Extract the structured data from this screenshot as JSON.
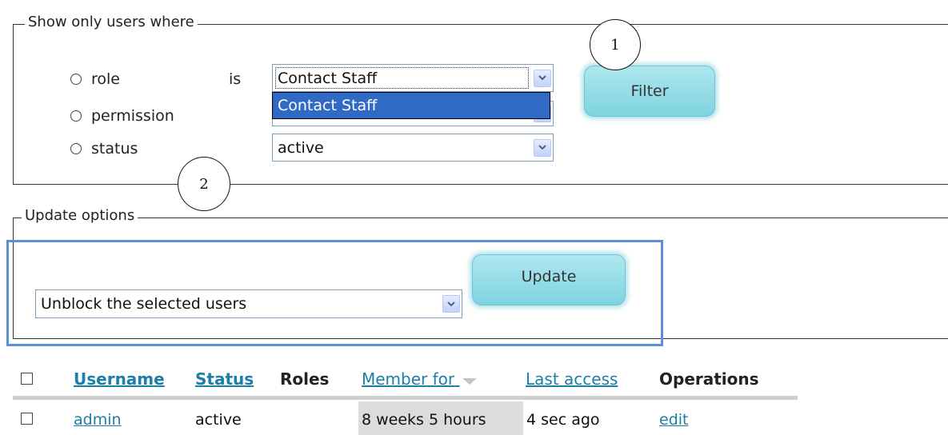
{
  "filter_fieldset": {
    "legend": "Show only users where",
    "options": [
      {
        "label": "role"
      },
      {
        "label": "permission"
      },
      {
        "label": "status"
      }
    ],
    "is_label": "is",
    "role_select": {
      "value": "Contact Staff",
      "dropdown_highlighted": "Contact Staff"
    },
    "status_select": {
      "value": "active"
    },
    "filter_button": "Filter"
  },
  "update_fieldset": {
    "legend": "Update options",
    "action_select": {
      "value": "Unblock the selected users"
    },
    "update_button": "Update"
  },
  "callouts": {
    "one": "1",
    "two": "2"
  },
  "table": {
    "columns": [
      {
        "label": "Username",
        "sortable": true
      },
      {
        "label": "Status",
        "sortable": true
      },
      {
        "label": "Roles",
        "sortable": false
      },
      {
        "label": "Member for",
        "sortable": true,
        "sorted": "desc"
      },
      {
        "label": "Last access",
        "sortable": true
      },
      {
        "label": "Operations",
        "sortable": false
      }
    ],
    "rows": [
      {
        "username": "admin",
        "status": "active",
        "roles": "",
        "member_for": "8 weeks 5 hours",
        "last_access": "4 sec ago",
        "operation": "edit"
      }
    ]
  },
  "colors": {
    "accent_link": "#1d7ea8",
    "button": "#8fdbe6",
    "highlight_frame": "#5b8fd8",
    "dropdown_selection": "#316ac5"
  }
}
